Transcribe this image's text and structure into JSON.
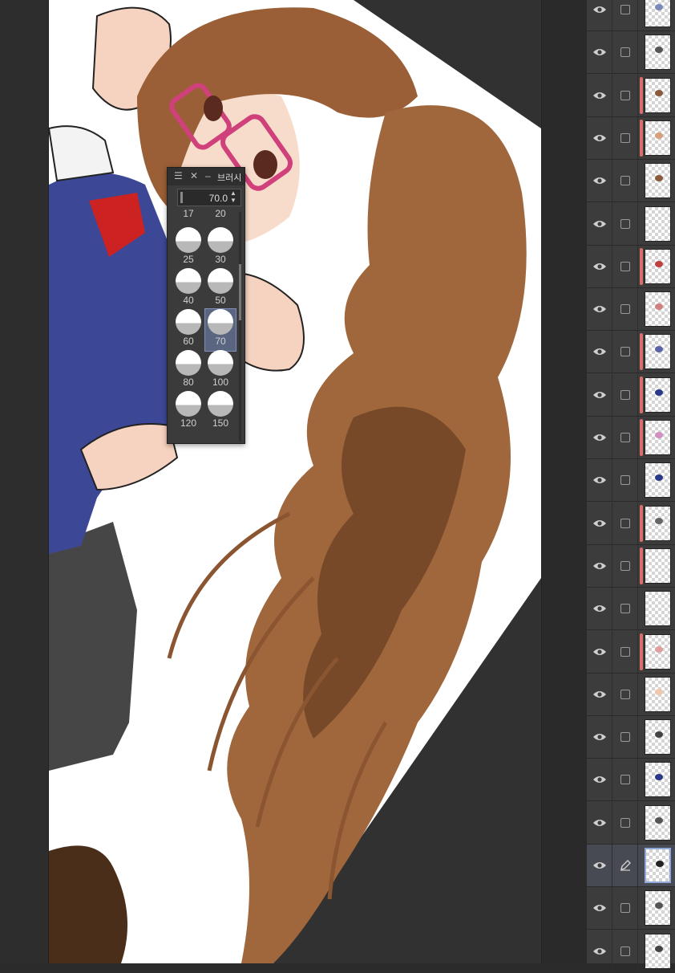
{
  "brush_palette": {
    "title": "브러시",
    "current_value": "70.0",
    "sizes": [
      {
        "label": "17",
        "selected": false
      },
      {
        "label": "20",
        "selected": false
      },
      {
        "label": "25",
        "selected": false
      },
      {
        "label": "30",
        "selected": false
      },
      {
        "label": "40",
        "selected": false
      },
      {
        "label": "50",
        "selected": false
      },
      {
        "label": "60",
        "selected": false
      },
      {
        "label": "70",
        "selected": true
      },
      {
        "label": "80",
        "selected": false
      },
      {
        "label": "100",
        "selected": false
      },
      {
        "label": "120",
        "selected": false
      },
      {
        "label": "150",
        "selected": false
      }
    ]
  },
  "layers": [
    {
      "clipped": false,
      "active": false,
      "mark": "#7b8ab8"
    },
    {
      "clipped": false,
      "active": false,
      "mark": "#555555"
    },
    {
      "clipped": true,
      "active": false,
      "mark": "#8a5a3a"
    },
    {
      "clipped": true,
      "active": false,
      "mark": "#d6a07a"
    },
    {
      "clipped": false,
      "active": false,
      "mark": "#8a5a3a"
    },
    {
      "clipped": false,
      "active": false,
      "mark": null
    },
    {
      "clipped": true,
      "active": false,
      "mark": "#c04040"
    },
    {
      "clipped": false,
      "active": false,
      "mark": "#d08080"
    },
    {
      "clipped": true,
      "active": false,
      "mark": "#5a64a8"
    },
    {
      "clipped": true,
      "active": false,
      "mark": "#2a3a8a"
    },
    {
      "clipped": true,
      "active": false,
      "mark": "#d090c0"
    },
    {
      "clipped": false,
      "active": false,
      "mark": "#2a3a8a"
    },
    {
      "clipped": true,
      "active": false,
      "mark": "#666666"
    },
    {
      "clipped": true,
      "active": false,
      "mark": null
    },
    {
      "clipped": false,
      "active": false,
      "mark": null
    },
    {
      "clipped": true,
      "active": false,
      "mark": "#e0a0a0"
    },
    {
      "clipped": false,
      "active": false,
      "mark": "#f0c8b0"
    },
    {
      "clipped": false,
      "active": false,
      "mark": "#444444"
    },
    {
      "clipped": false,
      "active": false,
      "mark": "#2a3a8a"
    },
    {
      "clipped": false,
      "active": false,
      "mark": "#555555"
    },
    {
      "clipped": false,
      "active": true,
      "mark": "#222222"
    },
    {
      "clipped": false,
      "active": false,
      "mark": "#555555"
    },
    {
      "clipped": false,
      "active": false,
      "mark": "#444444"
    }
  ],
  "colors": {
    "hair": "#a0673d",
    "hair_dark": "#6a3f22",
    "uniform": "#3a4590",
    "skirt": "#444444",
    "skin": "#f6d2c0",
    "glasses": "#d0407a",
    "ribbon": "#d02020",
    "clip_bar": "#d86f6f"
  }
}
